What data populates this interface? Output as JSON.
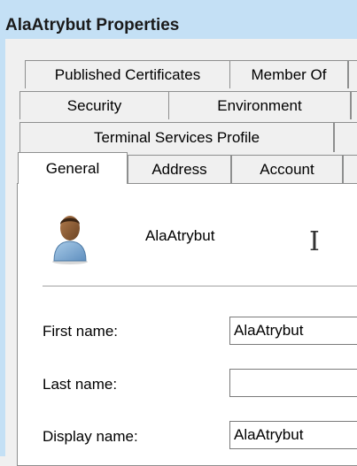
{
  "window": {
    "title": "AlaAtrybut Properties"
  },
  "tabs": {
    "row1": [
      "Published Certificates",
      "Member Of"
    ],
    "row2": [
      "Security",
      "Environment"
    ],
    "row3": [
      "Terminal Services Profile"
    ],
    "row4": [
      "General",
      "Address",
      "Account"
    ],
    "selected": "General"
  },
  "general": {
    "display_name": "AlaAtrybut",
    "first_name_label": "First name:",
    "first_name_value": "AlaAtrybut",
    "last_name_label": "Last name:",
    "last_name_value": "",
    "display_name_label": "Display name:",
    "display_name_value": "AlaAtrybut"
  },
  "icons": {
    "user": "user-icon",
    "cursor": "ibeam-cursor-icon"
  },
  "colors": {
    "titlebar": "#c4e0f5",
    "panel": "#ffffff",
    "background": "#f0f0f0"
  }
}
